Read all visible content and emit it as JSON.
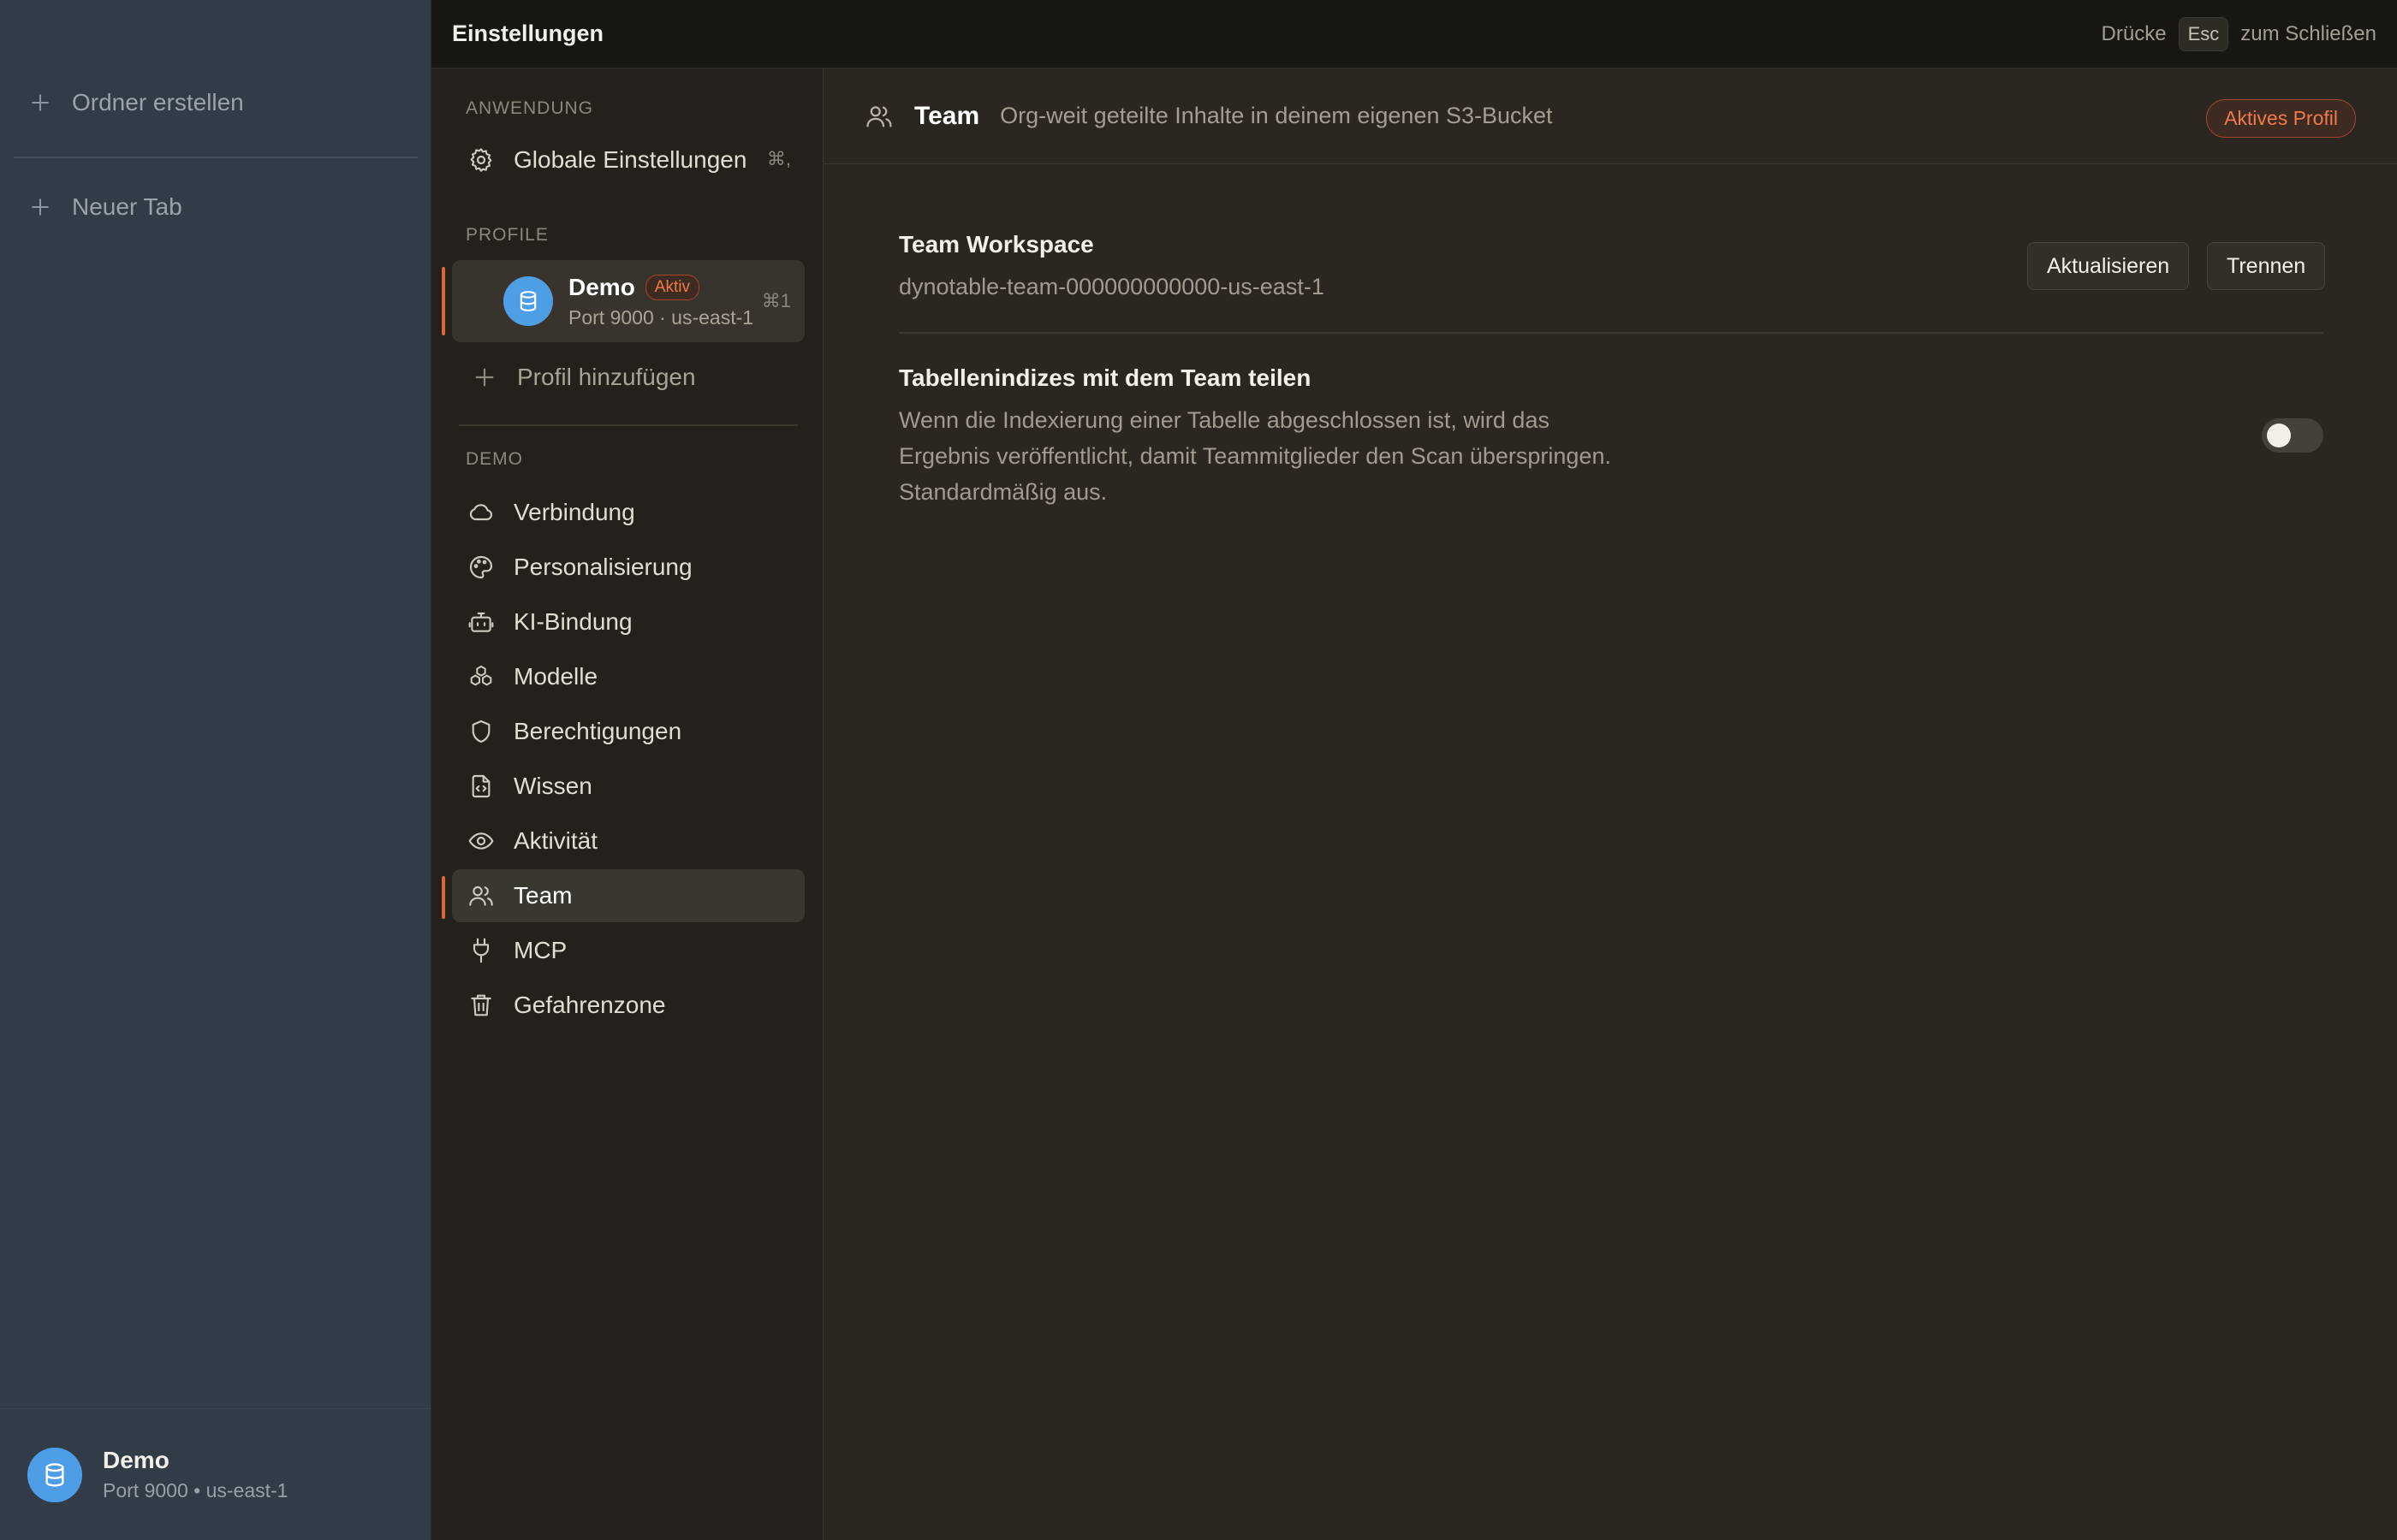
{
  "app_sidebar": {
    "create_folder": "Ordner erstellen",
    "new_tab": "Neuer Tab",
    "footer": {
      "name": "Demo",
      "sub": "Port 9000 • us-east-1"
    }
  },
  "topbar": {
    "title": "Einstellungen",
    "hint_prefix": "Drücke",
    "hint_key": "Esc",
    "hint_suffix": "zum Schließen"
  },
  "nav": {
    "section_app": "ANWENDUNG",
    "global_settings": "Globale Einstellungen",
    "global_shortcut": "⌘,",
    "section_profiles": "PROFILE",
    "profile": {
      "name": "Demo",
      "badge": "Aktiv",
      "sub": "Port 9000 · us-east-1",
      "shortcut": "⌘1"
    },
    "add_profile": "Profil hinzufügen",
    "section_demo": "DEMO",
    "items": [
      {
        "label": "Verbindung",
        "icon": "cloud-icon"
      },
      {
        "label": "Personalisierung",
        "icon": "palette-icon"
      },
      {
        "label": "KI-Bindung",
        "icon": "bot-icon"
      },
      {
        "label": "Modelle",
        "icon": "boxes-icon"
      },
      {
        "label": "Berechtigungen",
        "icon": "shield-icon"
      },
      {
        "label": "Wissen",
        "icon": "file-code-icon"
      },
      {
        "label": "Aktivität",
        "icon": "eye-icon"
      },
      {
        "label": "Team",
        "icon": "users-icon",
        "active": true
      },
      {
        "label": "MCP",
        "icon": "plug-icon"
      },
      {
        "label": "Gefahrenzone",
        "icon": "trash-icon"
      }
    ]
  },
  "content": {
    "title": "Team",
    "description": "Org-weit geteilte Inhalte in deinem eigenen S3-Bucket",
    "badge": "Aktives Profil",
    "workspace": {
      "title": "Team Workspace",
      "value": "dynotable-team-000000000000-us-east-1",
      "refresh_label": "Aktualisieren",
      "disconnect_label": "Trennen"
    },
    "share_indexes": {
      "title": "Tabellenindizes mit dem Team teilen",
      "line1": "Wenn die Indexierung einer Tabelle abgeschlossen ist, wird das",
      "line2": "Ergebnis veröffentlicht, damit Teammitglieder den Scan überspringen.",
      "line3": "Standardmäßig aus.",
      "enabled": false
    }
  },
  "colors": {
    "accent": "#e0663a",
    "db_blue": "#4e9ee6"
  }
}
